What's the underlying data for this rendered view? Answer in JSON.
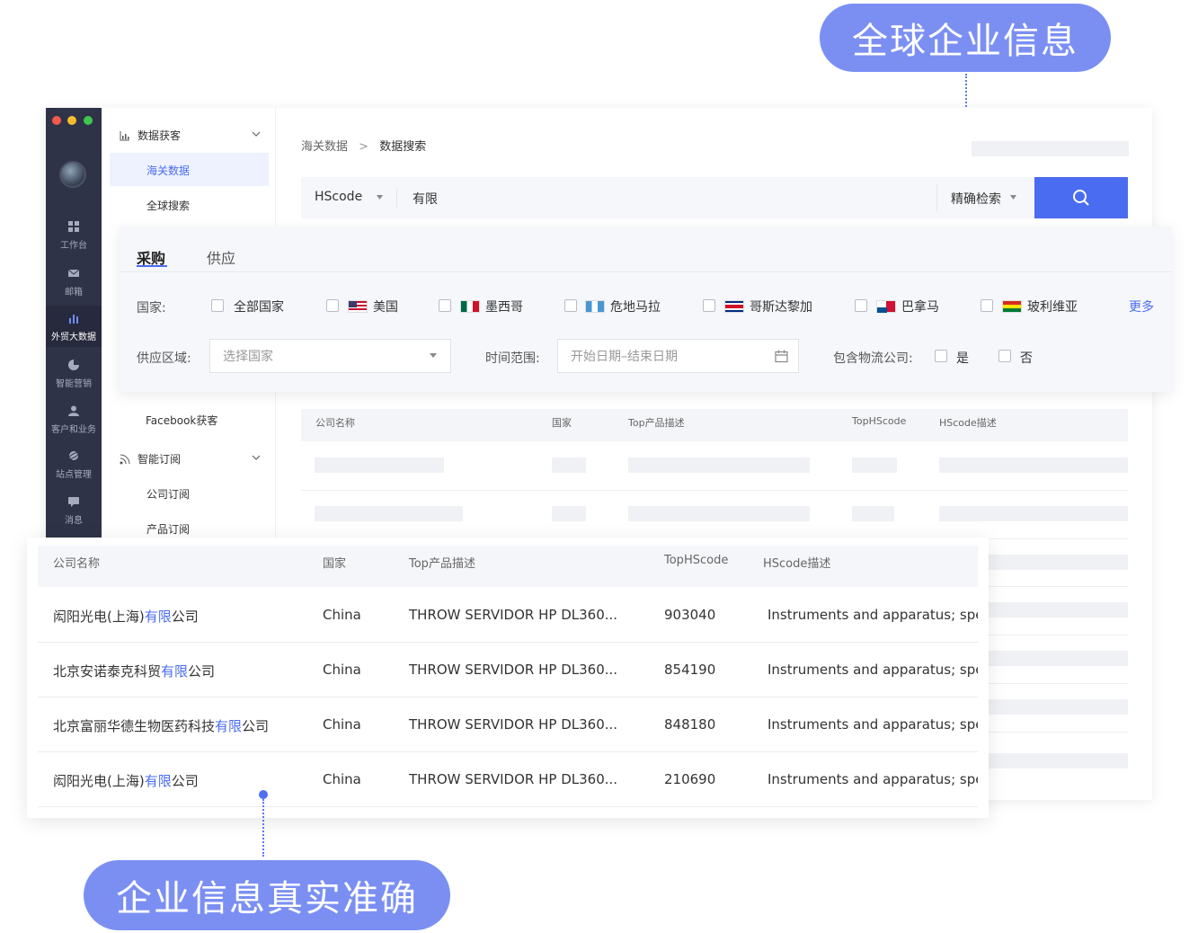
{
  "callouts": {
    "top": "全球企业信息",
    "bottom": "企业信息真实准确"
  },
  "sidebar": {
    "items": [
      {
        "label": "工作台",
        "icon": "grid-icon"
      },
      {
        "label": "邮箱",
        "icon": "mail-icon"
      },
      {
        "label": "外贸大数据",
        "icon": "bar-chart-icon",
        "active": true
      },
      {
        "label": "智能营销",
        "icon": "pie-chart-icon"
      },
      {
        "label": "客户和业务",
        "icon": "user-icon"
      },
      {
        "label": "站点管理",
        "icon": "globe-icon"
      },
      {
        "label": "消息",
        "icon": "message-icon"
      }
    ]
  },
  "menu": {
    "group1": "数据获客",
    "group1_items": [
      "海关数据",
      "全球搜索"
    ],
    "facebook": "Facebook获客",
    "group2": "智能订阅",
    "group2_items": [
      "公司订阅",
      "产品订阅"
    ]
  },
  "breadcrumb": {
    "parent": "海关数据",
    "separator": ">",
    "current": "数据搜索"
  },
  "search": {
    "type": "HScode",
    "query": "有限",
    "mode": "精确检索"
  },
  "filter": {
    "tabs": [
      "采购",
      "供应"
    ],
    "country_label": "国家:",
    "countries": [
      "全部国家",
      "美国",
      "墨西哥",
      "危地马拉",
      "哥斯达黎加",
      "巴拿马",
      "玻利维亚"
    ],
    "more": "更多",
    "region_label": "供应区域:",
    "region_placeholder": "选择国家",
    "time_label": "时间范围:",
    "time_placeholder": "开始日期–结束日期",
    "logistics_label": "包含物流公司:",
    "yes": "是",
    "no": "否"
  },
  "bg_table": {
    "headers": [
      "公司名称",
      "国家",
      "Top产品描述",
      "TopHScode",
      "HScode描述"
    ]
  },
  "table": {
    "headers": [
      "公司名称",
      "国家",
      "Top产品描述",
      "TopHScode",
      "HScode描述"
    ],
    "rows": [
      {
        "pre": "闳阳光电(上海)",
        "hl": "有限",
        "post": "公司",
        "country": "China",
        "product": "THROW SERVIDOR HP DL360...",
        "code": "903040",
        "desc": "Instruments and apparatus; spec"
      },
      {
        "pre": "北京安诺泰克科贸",
        "hl": "有限",
        "post": "公司",
        "country": "China",
        "product": "THROW SERVIDOR HP DL360...",
        "code": "854190",
        "desc": "Instruments and apparatus; spec"
      },
      {
        "pre": "北京富丽华德生物医药科技",
        "hl": "有限",
        "post": "公司",
        "country": "China",
        "product": "THROW SERVIDOR HP DL360...",
        "code": "848180",
        "desc": "Instruments and apparatus; spec"
      },
      {
        "pre": "闳阳光电(上海)",
        "hl": "有限",
        "post": "公司",
        "country": "China",
        "product": "THROW SERVIDOR HP DL360...",
        "code": "210690",
        "desc": "Instruments and apparatus; spec"
      }
    ]
  }
}
